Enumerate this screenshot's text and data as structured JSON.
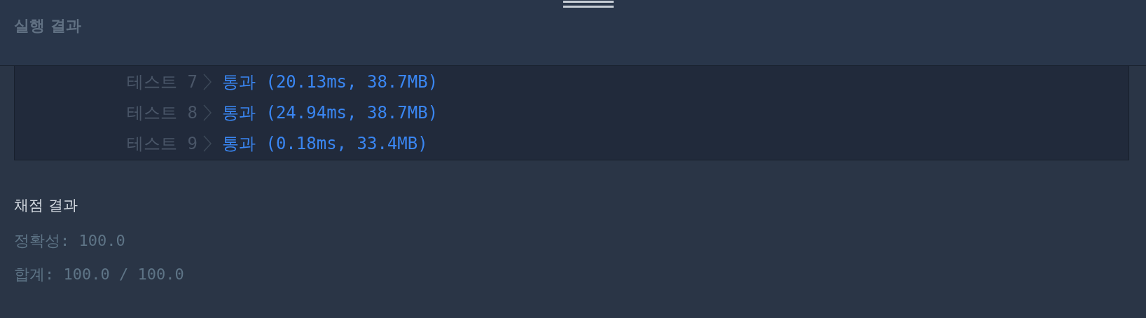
{
  "header": {
    "title": "실행 결과"
  },
  "tests": [
    {
      "label": "테스트 7",
      "result": "통과 (20.13ms, 38.7MB)"
    },
    {
      "label": "테스트 8",
      "result": "통과 (24.94ms, 38.7MB)"
    },
    {
      "label": "테스트 9",
      "result": "통과 (0.18ms, 33.4MB)"
    }
  ],
  "grading": {
    "title": "채점 결과",
    "lines": [
      "정확성: 100.0",
      "합계: 100.0 / 100.0"
    ]
  }
}
